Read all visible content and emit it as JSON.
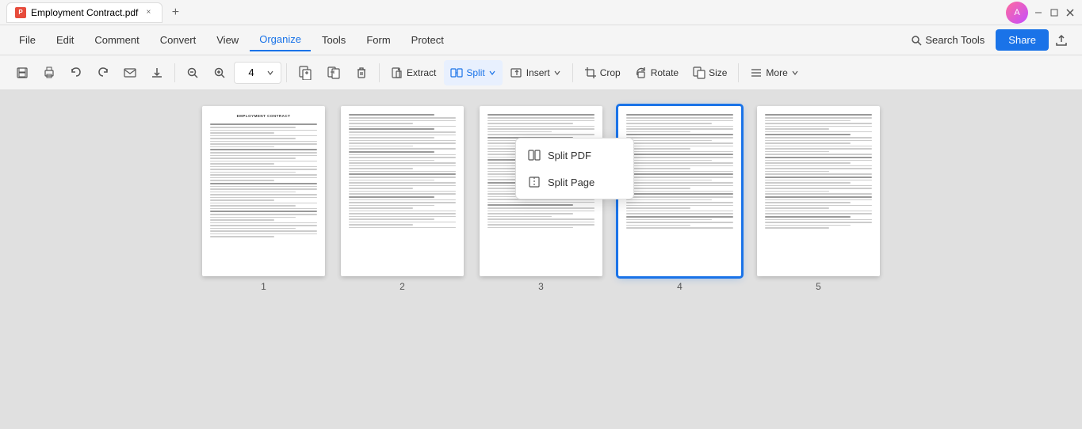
{
  "titleBar": {
    "tabLabel": "Employment Contract.pdf",
    "closeLabel": "×",
    "newTabLabel": "+",
    "minimizeLabel": "−",
    "maximizeLabel": "□",
    "closeWindowLabel": "×"
  },
  "menuBar": {
    "items": [
      {
        "id": "file",
        "label": "File"
      },
      {
        "id": "edit",
        "label": "Edit"
      },
      {
        "id": "comment",
        "label": "Comment"
      },
      {
        "id": "convert",
        "label": "Convert"
      },
      {
        "id": "view",
        "label": "View"
      },
      {
        "id": "organize",
        "label": "Organize"
      },
      {
        "id": "tools",
        "label": "Tools"
      },
      {
        "id": "form",
        "label": "Form"
      },
      {
        "id": "protect",
        "label": "Protect"
      }
    ],
    "searchTools": "Search Tools",
    "shareLabel": "Share"
  },
  "toolbar": {
    "zoomOut": "−",
    "zoomIn": "+",
    "pageValue": "4",
    "insertPage": "Insert Page",
    "deletePage": "Delete Page",
    "deleteIcon": "🗑",
    "extractLabel": "Extract",
    "splitLabel": "Split",
    "insertLabel": "Insert",
    "cropLabel": "Crop",
    "rotateLabel": "Rotate",
    "sizeLabel": "Size",
    "moreLabel": "More"
  },
  "split": {
    "dropdownItems": [
      {
        "id": "split-pdf",
        "label": "Split PDF"
      },
      {
        "id": "split-page",
        "label": "Split Page"
      }
    ]
  },
  "pages": [
    {
      "number": "1",
      "selected": false,
      "title": "EMPLOYMENT CONTRACT"
    },
    {
      "number": "2",
      "selected": false,
      "title": ""
    },
    {
      "number": "3",
      "selected": false,
      "title": ""
    },
    {
      "number": "4",
      "selected": true,
      "title": ""
    },
    {
      "number": "5",
      "selected": false,
      "title": ""
    }
  ]
}
